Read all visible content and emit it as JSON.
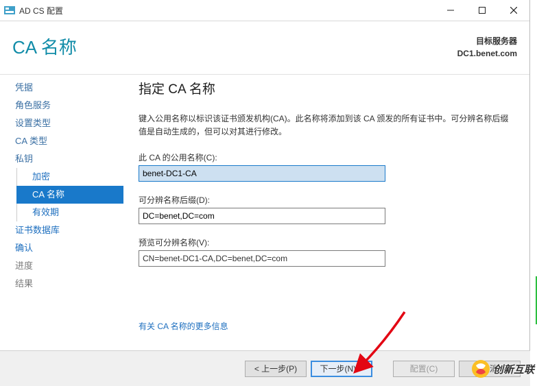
{
  "titlebar": {
    "app_title": "AD CS 配置"
  },
  "header": {
    "title": "CA 名称",
    "target_label": "目标服务器",
    "target_value": "DC1.benet.com"
  },
  "sidebar": {
    "items": [
      {
        "label": "凭据"
      },
      {
        "label": "角色服务"
      },
      {
        "label": "设置类型"
      },
      {
        "label": "CA 类型"
      },
      {
        "label": "私钥"
      },
      {
        "label": "加密"
      },
      {
        "label": "CA 名称"
      },
      {
        "label": "有效期"
      },
      {
        "label": "证书数据库"
      },
      {
        "label": "确认"
      },
      {
        "label": "进度"
      },
      {
        "label": "结果"
      }
    ]
  },
  "main": {
    "heading": "指定 CA 名称",
    "description": "键入公用名称以标识该证书颁发机构(CA)。此名称将添加到该 CA 颁发的所有证书中。可分辨名称后缀值是自动生成的，但可以对其进行修改。",
    "common_name_label": "此 CA 的公用名称(C):",
    "common_name_value": "benet-DC1-CA",
    "dn_suffix_label": "可分辨名称后缀(D):",
    "dn_suffix_value": "DC=benet,DC=com",
    "preview_label": "预览可分辨名称(V):",
    "preview_value": "CN=benet-DC1-CA,DC=benet,DC=com",
    "more_link": "有关 CA 名称的更多信息"
  },
  "footer": {
    "prev": "< 上一步(P)",
    "next": "下一步(N) >",
    "configure": "配置(C)",
    "cancel": "取消"
  },
  "watermark": {
    "text": "创新互联"
  }
}
